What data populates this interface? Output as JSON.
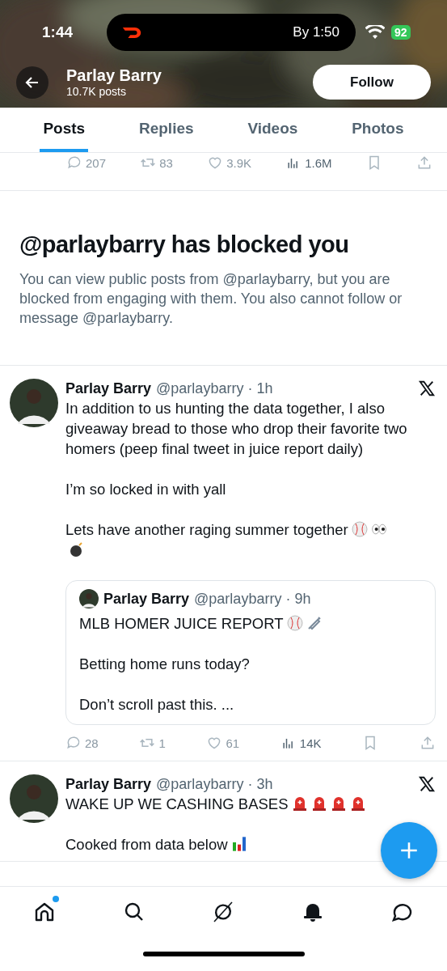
{
  "status_bar": {
    "time": "1:44",
    "activity": "By 1:50",
    "battery": "92"
  },
  "header": {
    "name": "Parlay Barry",
    "posts_count": "10.7K posts",
    "follow_button": "Follow"
  },
  "tabs": [
    {
      "label": "Posts",
      "selected": true
    },
    {
      "label": "Replies",
      "selected": false
    },
    {
      "label": "Videos",
      "selected": false
    },
    {
      "label": "Photos",
      "selected": false
    }
  ],
  "previous_actions": [
    {
      "kind": "reply",
      "count": "207",
      "disabled": true
    },
    {
      "kind": "repost",
      "count": "83",
      "disabled": true
    },
    {
      "kind": "like",
      "count": "3.9K",
      "disabled": true
    },
    {
      "kind": "views",
      "count": "1.6M",
      "disabled": false
    },
    {
      "kind": "bookmark",
      "disabled": true
    },
    {
      "kind": "share",
      "disabled": true
    }
  ],
  "blocked_notice": {
    "title": "@parlaybarry has blocked you",
    "text": "You can view public posts from @parlaybarry, but you are blocked from engaging with them. You also cannot follow or message @parlaybarry."
  },
  "posts": [
    {
      "name": "Parlay Barry",
      "handle": "@parlaybarry · 1h",
      "paragraphs": [
        "In addition to us hunting the data together, I also giveaway bread to those who drop their favorite two homers (peep final tweet in juice report daily)",
        "I’m so locked in with yall",
        "Lets have another raging summer together"
      ],
      "quote": {
        "name": "Parlay Barry",
        "handle": "@parlaybarry · 9h",
        "paragraphs": [
          "MLB HOMER JUICE REPORT",
          "Betting home runs today?",
          "Don’t scroll past this. ..."
        ]
      },
      "actions": [
        {
          "kind": "reply",
          "count": "28",
          "disabled": true
        },
        {
          "kind": "repost",
          "count": "1",
          "disabled": true
        },
        {
          "kind": "like",
          "count": "61",
          "disabled": true
        },
        {
          "kind": "views",
          "count": "14K",
          "disabled": false
        },
        {
          "kind": "bookmark",
          "disabled": true
        },
        {
          "kind": "share",
          "disabled": true
        }
      ]
    },
    {
      "name": "Parlay Barry",
      "handle": "@parlaybarry · 3h",
      "paragraphs": [
        "WAKE UP WE CASHING BASES",
        "Cooked from data below"
      ]
    }
  ],
  "nav": [
    {
      "kind": "home",
      "badge": true
    },
    {
      "kind": "search",
      "badge": false
    },
    {
      "kind": "grok",
      "badge": false
    },
    {
      "kind": "notifications",
      "badge": false
    },
    {
      "kind": "messages",
      "badge": false
    }
  ]
}
